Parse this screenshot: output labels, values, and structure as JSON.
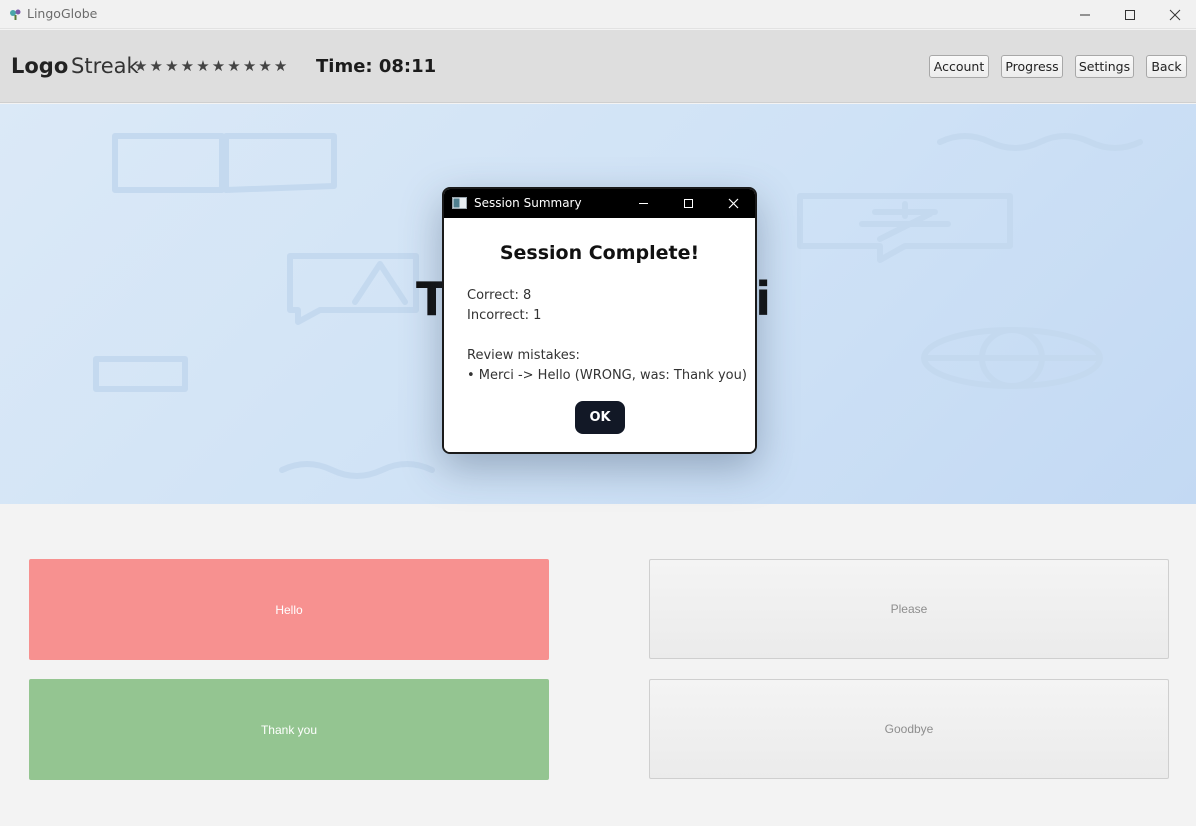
{
  "window": {
    "title": "LingoGlobe",
    "controls": {
      "minimize": "minimize",
      "maximize": "maximize",
      "close": "close"
    }
  },
  "header": {
    "logo": "Logo",
    "streak_label": "Streak",
    "streak_stars": "★★★★★★★★★★",
    "timer": "Time: 08:11",
    "buttons": {
      "account": "Account",
      "progress": "Progress",
      "settings": "Settings",
      "back": "Back"
    }
  },
  "hero": {
    "word_left_visible": "T",
    "word_right_visible": "ci"
  },
  "answers": [
    {
      "label": "Hello",
      "state": "wrong",
      "color": "#f79190"
    },
    {
      "label": "Please",
      "state": "neutral",
      "color": "#eeeeee"
    },
    {
      "label": "Thank you",
      "state": "correct",
      "color": "#94c591"
    },
    {
      "label": "Goodbye",
      "state": "neutral",
      "color": "#eeeeee"
    }
  ],
  "dialog": {
    "title": "Session Summary",
    "heading": "Session Complete!",
    "correct": "Correct: 8",
    "incorrect": "Incorrect: 1",
    "review_label": "Review mistakes:",
    "mistake_1": "• Merci -> Hello (WRONG, was: Thank you)",
    "ok_label": "OK"
  },
  "colors": {
    "header_bg": "#dedede",
    "hero_bg": "#cfe2f6",
    "dialog_titlebar": "#000000",
    "ok_button": "#121826"
  }
}
